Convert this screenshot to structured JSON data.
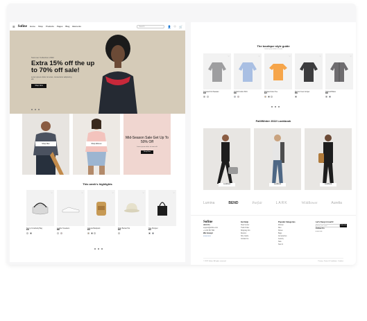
{
  "nav": {
    "logo": "Sofine",
    "links": [
      "Home",
      "Shop",
      "Products",
      "Pages",
      "Blog",
      "Elements"
    ],
    "search_placeholder": "Search"
  },
  "hero": {
    "subtitle": "Summer Collection 2022",
    "title": "Extra 15% off the up to 70% off sale!",
    "desc": "Lorem ipsum dolor sit amet, consectetur adipiscing elit.",
    "button": "Shop Now"
  },
  "cards": {
    "card1_tag": "Shop Men",
    "card2_tag": "Shop Women",
    "promo_title": "Mid-Season Sale Get Up To 50% Off",
    "promo_desc": "Lorem ipsum dolor sit amet elit",
    "promo_button": "Shop Now"
  },
  "highlights": {
    "title": "This week's highlights",
    "products": [
      {
        "name": "Sunny Crossbody Bag",
        "price": "$45"
      },
      {
        "name": "Leather Sneakers",
        "price": "$88"
      },
      {
        "name": "Canvas Backpack",
        "price": "$64"
      },
      {
        "name": "Wool Bucket Hat",
        "price": "$29"
      },
      {
        "name": "Tote Shopper",
        "price": "$52"
      }
    ]
  },
  "boutique": {
    "title": "The boutique style guide",
    "subtitle": "Lorem ipsum dolor sit amet",
    "products": [
      {
        "name": "Textured Knit Sweater",
        "price": "$48"
      },
      {
        "name": "Oxford Cotton Shirt",
        "price": "$39"
      },
      {
        "name": "Relaxed Linen Tee",
        "price": "$24"
      },
      {
        "name": "Merino Crew Jumper",
        "price": "$59"
      },
      {
        "name": "Tailored Blazer",
        "price": "$99"
      }
    ]
  },
  "lookbook": {
    "title": "Fall/Winter 2022 Lookbook",
    "tag": "Lookbook"
  },
  "brands": [
    "Lumina",
    "BEND",
    "Parfait",
    "LARK",
    "Wildflower",
    "Aurelia"
  ],
  "footer": {
    "logo": "Sofine",
    "col1_title": "Join Us",
    "col1_lines": [
      "support@sofine.com",
      "+1 234 567 890"
    ],
    "payments_title": "We Accept",
    "col2_title": "Get Help",
    "col2_links": [
      "Help Center",
      "Track Order",
      "Shipping Info",
      "Returns",
      "Size Guide",
      "Contact Us"
    ],
    "col3_title": "Popular Categories",
    "col3_links": [
      "Women",
      "Men",
      "Shoes",
      "Bags",
      "Accessories",
      "Jewelry",
      "Sale",
      "New In"
    ],
    "col4_title": "Let's Keep in touch!",
    "email_placeholder": "Enter your email",
    "subscribe": "Subscribe",
    "follow": "Follow Us",
    "copyright": "© 2022 Sofine. All rights reserved.",
    "bottom_links": [
      "Privacy",
      "Terms & Conditions",
      "Cookies"
    ]
  }
}
